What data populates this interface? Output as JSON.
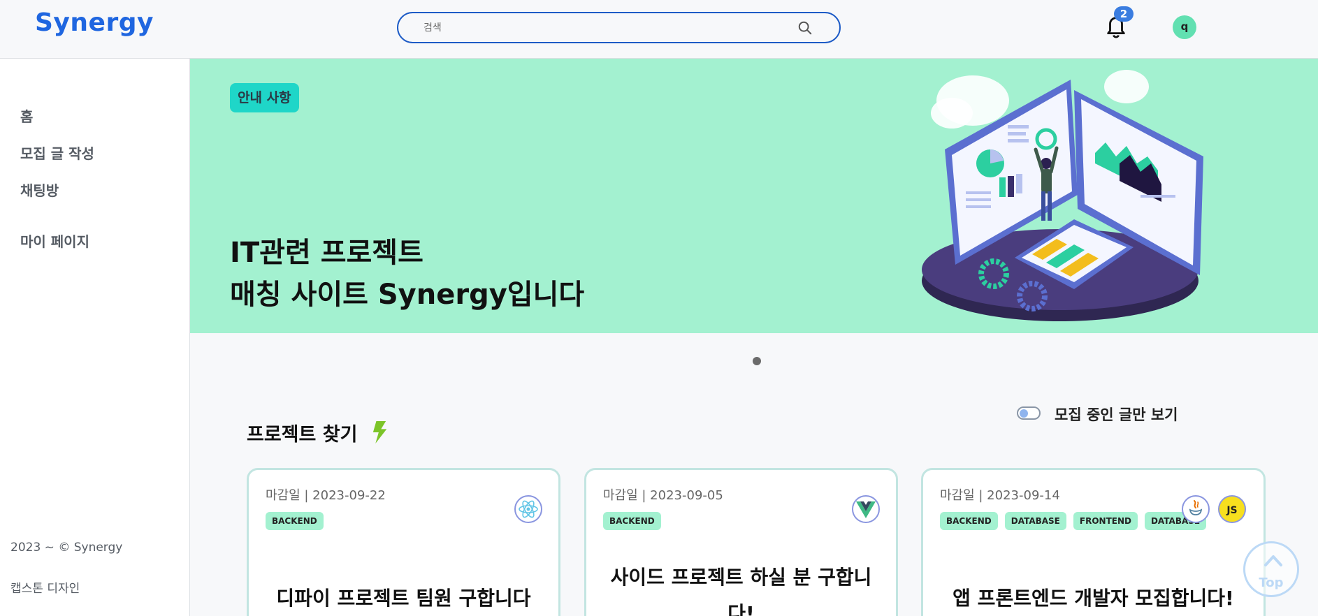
{
  "header": {
    "logo": "Synergy",
    "search_placeholder": "검색",
    "notification_count": "2",
    "avatar_initial": "q"
  },
  "sidebar": {
    "items": [
      {
        "label": "홈"
      },
      {
        "label": "모집 글 작성"
      },
      {
        "label": "채팅방"
      },
      {
        "label": "마이 페이지"
      }
    ],
    "footer": {
      "copyright": "2023 ~ © Synergy",
      "subtitle": "캡스톤 디자인"
    }
  },
  "banner": {
    "badge": "안내 사항",
    "title_line1": "IT관련 프로젝트",
    "title_line2": "매칭 사이트 Synergy입니다"
  },
  "section": {
    "title": "프로젝트 찾기",
    "toggle_label": "모집 중인 글만 보기",
    "toggle_on": false
  },
  "cards": [
    {
      "deadline": "마감일 | 2023-09-22",
      "tags": [
        "BACKEND"
      ],
      "icons": [
        "react-icon"
      ],
      "title": "디파이 프로젝트 팀원 구합니다"
    },
    {
      "deadline": "마감일 | 2023-09-05",
      "tags": [
        "BACKEND"
      ],
      "icons": [
        "vue-icon"
      ],
      "title": "사이드 프로젝트 하실 분 구합니다!"
    },
    {
      "deadline": "마감일 | 2023-09-14",
      "tags": [
        "BACKEND",
        "DATABASE",
        "FRONTEND",
        "DATABASE"
      ],
      "icons": [
        "java-icon",
        "javascript-icon"
      ],
      "title": "앱 프론트엔드 개발자 모집합니다!"
    }
  ],
  "top_button": {
    "label": "Top"
  },
  "colors": {
    "brand": "#1f66e0",
    "banner": "#a3f1d0",
    "badge": "#1fd6c8",
    "tag": "#a3f1d0",
    "card_border": "#c2e5e1"
  }
}
